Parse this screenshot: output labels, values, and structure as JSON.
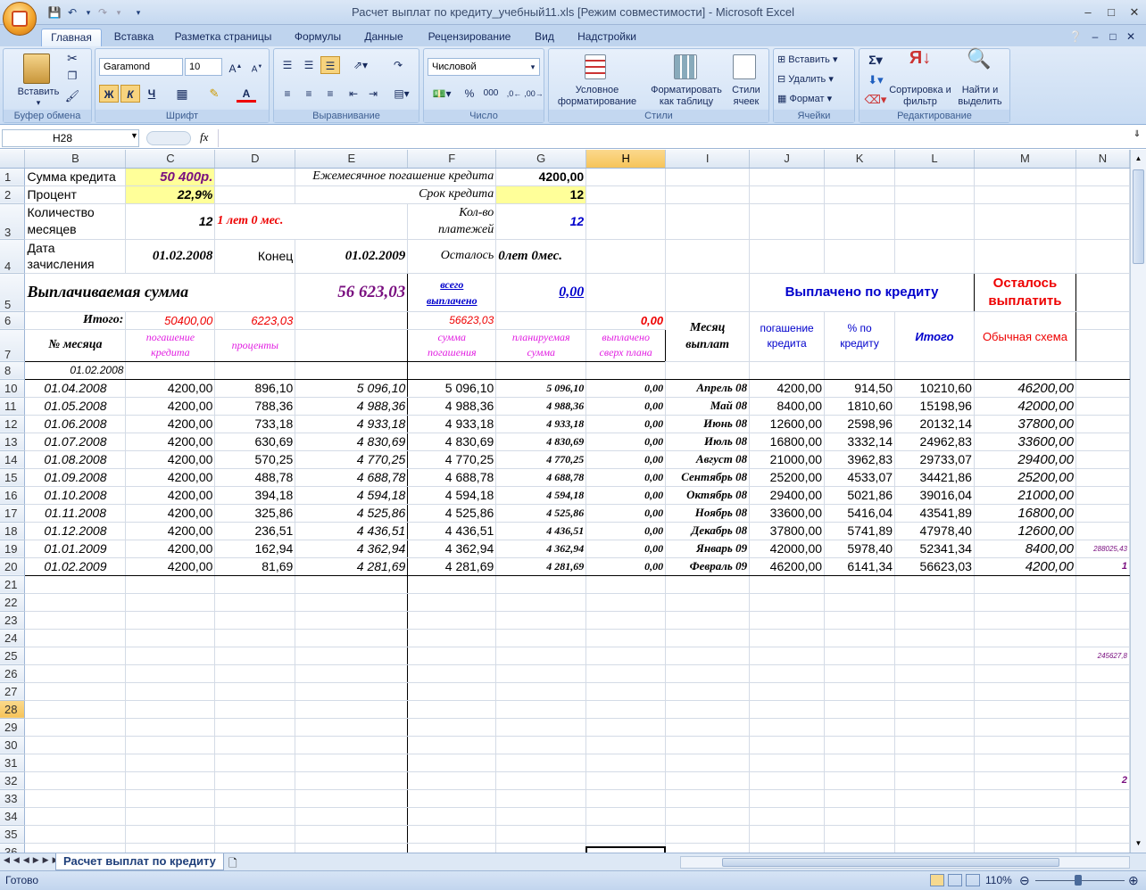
{
  "window": {
    "title": "Расчет выплат по кредиту_учебный11.xls  [Режим совместимости] - Microsoft Excel"
  },
  "ribbon": {
    "tabs": [
      "Главная",
      "Вставка",
      "Разметка страницы",
      "Формулы",
      "Данные",
      "Рецензирование",
      "Вид",
      "Надстройки"
    ],
    "active_tab": "Главная",
    "clipboard": {
      "paste": "Вставить",
      "label": "Буфер обмена"
    },
    "font": {
      "name": "Garamond",
      "size": "10",
      "bold": "Ж",
      "italic": "К",
      "underline": "Ч",
      "label": "Шрифт"
    },
    "alignment": {
      "label": "Выравнивание"
    },
    "number": {
      "format": "Числовой",
      "percent": "%",
      "thousands": "000",
      "label": "Число"
    },
    "styles": {
      "conditional": "Условное форматирование",
      "as_table": "Форматировать как таблицу",
      "cell_styles": "Стили ячеек",
      "label": "Стили"
    },
    "cells": {
      "insert": "Вставить",
      "delete": "Удалить",
      "format": "Формат",
      "label": "Ячейки"
    },
    "editing": {
      "sort": "Сортировка и фильтр",
      "find": "Найти и выделить",
      "label": "Редактирование"
    }
  },
  "formula_bar": {
    "name_box": "H28",
    "fx": "fx",
    "formula": ""
  },
  "columns": [
    "B",
    "C",
    "D",
    "E",
    "F",
    "G",
    "H",
    "I",
    "J",
    "K",
    "L",
    "M",
    "N"
  ],
  "cells": {
    "b1": "Сумма кредита",
    "c1": "50 400р.",
    "e1": "Ежемесячное погашение кредита",
    "g1": "4200,00",
    "b2": "Процент",
    "c2": "22,9%",
    "e2": "Срок кредита",
    "g2": "12",
    "b3a": "Количество",
    "b3b": "месяцев",
    "c3": "12",
    "d3": "1 лет 0 мес.",
    "f3a": "Кол-во",
    "f3b": "платежей",
    "g3": "12",
    "b4a": "Дата",
    "b4b": "зачисления",
    "c4": "01.02.2008",
    "d4": "Конец",
    "e4": "01.02.2009",
    "f4": "Осталось",
    "g4": "0лет 0мес.",
    "b5": "Выплачиваемая сумма",
    "e5": "56 623,03",
    "f5a": "всего",
    "f5b": "выплачено",
    "g5": "0,00",
    "j5": "Выплачено по кредиту",
    "m5a": "Осталось",
    "m5b": "выплатить",
    "b6": "Итого:",
    "c6": "50400,00",
    "d6": "6223,03",
    "f6": "56623,03",
    "h6": "0,00",
    "i67a": "Месяц",
    "i67b": "выплат",
    "j67a": "погашение",
    "j67b": "кредита",
    "k67a": "% по",
    "k67b": "кредиту",
    "l67": "Итого",
    "m67": "Обычная схема",
    "b7": "№ месяца",
    "c7a": "погашение",
    "c7b": "кредита",
    "d7": "проценты",
    "f7a": "сумма",
    "f7b": "погашения",
    "g7a": "планируемая",
    "g7b": "сумма",
    "h7a": "выплачено",
    "h7b": "сверх плана",
    "b8": "01.02.2008",
    "n19": "288025,43",
    "n20": "1",
    "n25": "245627,8",
    "n32": "2"
  },
  "rows": [
    {
      "n": "10",
      "date": "01.04.2008",
      "c": "4200,00",
      "d": "896,10",
      "e": "5 096,10",
      "f": "5 096,10",
      "g": "5 096,10",
      "h": "0,00",
      "i": "Апрель 08",
      "j": "4200,00",
      "k": "914,50",
      "l": "10210,60",
      "m": "46200,00"
    },
    {
      "n": "11",
      "date": "01.05.2008",
      "c": "4200,00",
      "d": "788,36",
      "e": "4 988,36",
      "f": "4 988,36",
      "g": "4 988,36",
      "h": "0,00",
      "i": "Май 08",
      "j": "8400,00",
      "k": "1810,60",
      "l": "15198,96",
      "m": "42000,00"
    },
    {
      "n": "12",
      "date": "01.06.2008",
      "c": "4200,00",
      "d": "733,18",
      "e": "4 933,18",
      "f": "4 933,18",
      "g": "4 933,18",
      "h": "0,00",
      "i": "Июнь 08",
      "j": "12600,00",
      "k": "2598,96",
      "l": "20132,14",
      "m": "37800,00"
    },
    {
      "n": "13",
      "date": "01.07.2008",
      "c": "4200,00",
      "d": "630,69",
      "e": "4 830,69",
      "f": "4 830,69",
      "g": "4 830,69",
      "h": "0,00",
      "i": "Июль 08",
      "j": "16800,00",
      "k": "3332,14",
      "l": "24962,83",
      "m": "33600,00"
    },
    {
      "n": "14",
      "date": "01.08.2008",
      "c": "4200,00",
      "d": "570,25",
      "e": "4 770,25",
      "f": "4 770,25",
      "g": "4 770,25",
      "h": "0,00",
      "i": "Август 08",
      "j": "21000,00",
      "k": "3962,83",
      "l": "29733,07",
      "m": "29400,00"
    },
    {
      "n": "15",
      "date": "01.09.2008",
      "c": "4200,00",
      "d": "488,78",
      "e": "4 688,78",
      "f": "4 688,78",
      "g": "4 688,78",
      "h": "0,00",
      "i": "Сентябрь 08",
      "j": "25200,00",
      "k": "4533,07",
      "l": "34421,86",
      "m": "25200,00"
    },
    {
      "n": "16",
      "date": "01.10.2008",
      "c": "4200,00",
      "d": "394,18",
      "e": "4 594,18",
      "f": "4 594,18",
      "g": "4 594,18",
      "h": "0,00",
      "i": "Октябрь 08",
      "j": "29400,00",
      "k": "5021,86",
      "l": "39016,04",
      "m": "21000,00"
    },
    {
      "n": "17",
      "date": "01.11.2008",
      "c": "4200,00",
      "d": "325,86",
      "e": "4 525,86",
      "f": "4 525,86",
      "g": "4 525,86",
      "h": "0,00",
      "i": "Ноябрь 08",
      "j": "33600,00",
      "k": "5416,04",
      "l": "43541,89",
      "m": "16800,00"
    },
    {
      "n": "18",
      "date": "01.12.2008",
      "c": "4200,00",
      "d": "236,51",
      "e": "4 436,51",
      "f": "4 436,51",
      "g": "4 436,51",
      "h": "0,00",
      "i": "Декабрь 08",
      "j": "37800,00",
      "k": "5741,89",
      "l": "47978,40",
      "m": "12600,00"
    },
    {
      "n": "19",
      "date": "01.01.2009",
      "c": "4200,00",
      "d": "162,94",
      "e": "4 362,94",
      "f": "4 362,94",
      "g": "4 362,94",
      "h": "0,00",
      "i": "Январь 09",
      "j": "42000,00",
      "k": "5978,40",
      "l": "52341,34",
      "m": "8400,00"
    },
    {
      "n": "20",
      "date": "01.02.2009",
      "c": "4200,00",
      "d": "81,69",
      "e": "4 281,69",
      "f": "4 281,69",
      "g": "4 281,69",
      "h": "0,00",
      "i": "Февраль 09",
      "j": "46200,00",
      "k": "6141,34",
      "l": "56623,03",
      "m": "4200,00"
    }
  ],
  "empty_rows": [
    "21",
    "22",
    "23",
    "24",
    "25",
    "26",
    "27",
    "28",
    "29",
    "30",
    "31",
    "32",
    "33",
    "34",
    "35",
    "36"
  ],
  "sheet_tab": "Расчет выплат по кредиту",
  "status": {
    "ready": "Готово",
    "zoom": "110%"
  },
  "colors": {
    "accent": "#f6c45a",
    "ribbon": "#c9dcf3",
    "highlight_yellow": "#ffff99"
  }
}
